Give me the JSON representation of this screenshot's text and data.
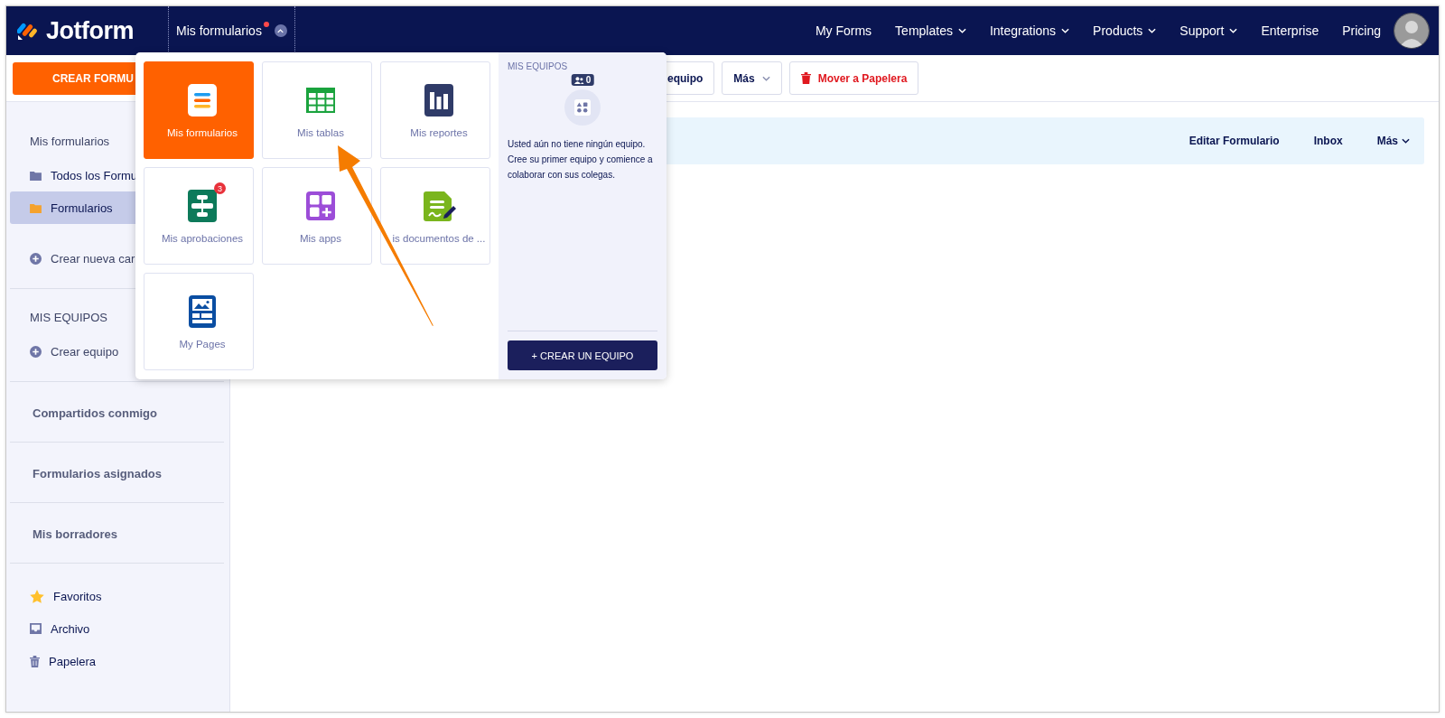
{
  "header": {
    "brand": "Jotform",
    "workspace_menu": {
      "label": "Mis formularios",
      "notification": true,
      "expanded": true
    },
    "nav": [
      {
        "label": "My Forms",
        "kind": "link"
      },
      {
        "label": "Templates",
        "kind": "dropdown"
      },
      {
        "label": "Integrations",
        "kind": "dropdown"
      },
      {
        "label": "Products",
        "kind": "dropdown"
      },
      {
        "label": "Support",
        "kind": "dropdown"
      },
      {
        "label": "Enterprise",
        "kind": "link"
      },
      {
        "label": "Pricing",
        "kind": "link"
      }
    ]
  },
  "toolbar": {
    "create_button": "CREAR FORMU",
    "buttons": [
      {
        "label": "equipo",
        "kind": "plain"
      },
      {
        "label": "Más",
        "kind": "menu"
      },
      {
        "label": "Mover a Papelera",
        "kind": "danger"
      }
    ]
  },
  "sidebar": {
    "sections": [
      {
        "title": "Mis formularios",
        "kind": "heading",
        "items": [
          {
            "label": "Todos los Formu",
            "kind": "folder",
            "color": "#6f76a7",
            "selected": false
          },
          {
            "label": "Formularios",
            "kind": "folder",
            "color": "#f5a22d",
            "selected": true
          },
          {
            "label": "Crear nueva car",
            "kind": "create",
            "selected": false
          }
        ]
      },
      {
        "title": "MIS EQUIPOS",
        "kind": "heading",
        "items": [
          {
            "label": "Crear equipo",
            "kind": "create",
            "selected": false
          }
        ]
      },
      {
        "title": "Compartidos conmigo",
        "kind": "link"
      },
      {
        "title": "Formularios asignados",
        "kind": "link"
      },
      {
        "title": "Mis borradores",
        "kind": "link"
      },
      {
        "items": [
          {
            "label": "Favoritos",
            "kind": "star",
            "selected": false
          },
          {
            "label": "Archivo",
            "kind": "archive",
            "selected": false
          },
          {
            "label": "Papelera",
            "kind": "trash",
            "selected": false
          }
        ]
      }
    ]
  },
  "form_row": {
    "actions": [
      {
        "label": "Editar Formulario",
        "kind": "link"
      },
      {
        "label": "Inbox",
        "kind": "link"
      },
      {
        "label": "Más",
        "kind": "dropdown"
      }
    ]
  },
  "apps_menu": {
    "tiles": [
      {
        "label": "Mis formularios",
        "kind": "forms",
        "selected": true
      },
      {
        "label": "Mis tablas",
        "kind": "tables",
        "selected": false
      },
      {
        "label": "Mis reportes",
        "kind": "reports",
        "selected": false
      },
      {
        "label": "Mis aprobaciones",
        "kind": "approvals",
        "selected": false,
        "badge": "3"
      },
      {
        "label": "Mis apps",
        "kind": "apps",
        "selected": false
      },
      {
        "label": "is documentos de ...",
        "kind": "sign",
        "selected": false
      },
      {
        "label": "My Pages",
        "kind": "pages",
        "selected": false
      }
    ],
    "teams": {
      "title": "MIS EQUIPOS",
      "count": "0",
      "message": "Usted aún no tiene ningún equipo. Cree su primer equipo y comience a colaborar con sus colegas.",
      "button": "+ CREAR UN EQUIPO"
    }
  }
}
